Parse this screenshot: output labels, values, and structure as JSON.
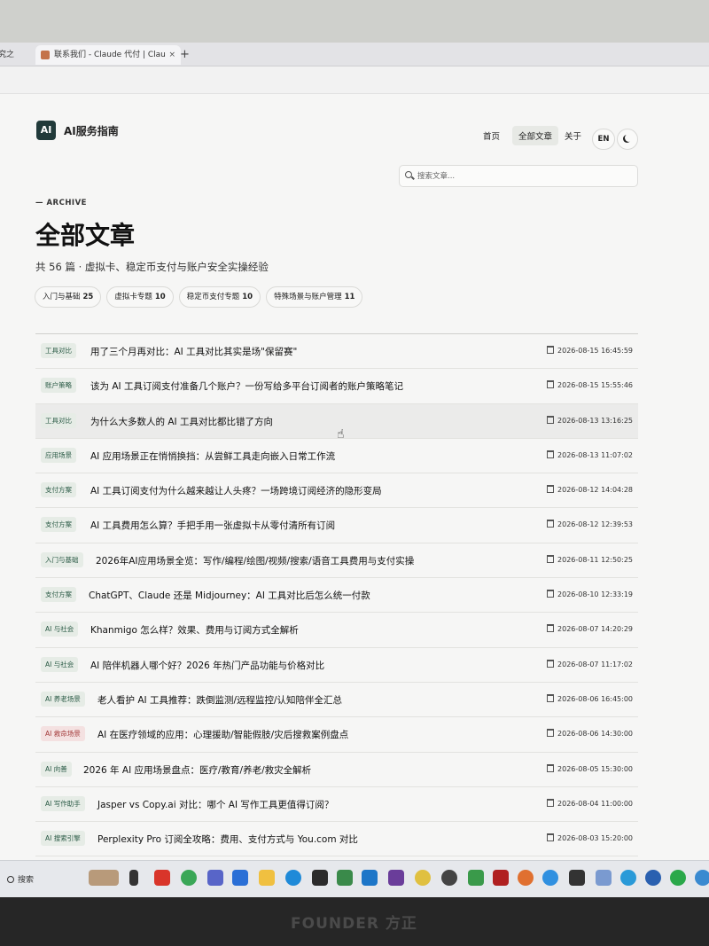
{
  "browser": {
    "tab1_label": "究之",
    "tab2_label": "联系我们 - Claude 代付 | Clau",
    "close_glyph": "×",
    "new_tab_glyph": "+"
  },
  "site": {
    "logo_text": "AI",
    "title": "AI服务指南",
    "nav": [
      "首页",
      "全部文章",
      "关于"
    ],
    "lang_button": "EN",
    "search_placeholder": "搜索文章..."
  },
  "hero": {
    "eyebrow": "— ARCHIVE",
    "title": "全部文章",
    "subtitle": "共 56 篇 · 虚拟卡、稳定币支付与账户安全实操经验"
  },
  "filters": [
    {
      "label": "入门与基础",
      "count": "25"
    },
    {
      "label": "虚拟卡专题",
      "count": "10"
    },
    {
      "label": "稳定币支付专题",
      "count": "10"
    },
    {
      "label": "特殊场景与账户管理",
      "count": "11"
    }
  ],
  "articles": [
    {
      "tag": "工具对比",
      "title": "用了三个月再对比：AI 工具对比其实是场\"保留赛\"",
      "date": "2026-08-15 16:45:59"
    },
    {
      "tag": "账户策略",
      "title": "该为 AI 工具订阅支付准备几个账户？一份写给多平台订阅者的账户策略笔记",
      "date": "2026-08-15 15:55:46"
    },
    {
      "tag": "工具对比",
      "title": "为什么大多数人的 AI 工具对比都比错了方向",
      "date": "2026-08-13 13:16:25"
    },
    {
      "tag": "应用场景",
      "title": "AI 应用场景正在悄悄换挡：从尝鲜工具走向嵌入日常工作流",
      "date": "2026-08-13 11:07:02"
    },
    {
      "tag": "支付方案",
      "title": "AI 工具订阅支付为什么越来越让人头疼？一场跨境订阅经济的隐形变局",
      "date": "2026-08-12 14:04:28"
    },
    {
      "tag": "支付方案",
      "title": "AI 工具费用怎么算？手把手用一张虚拟卡从零付清所有订阅",
      "date": "2026-08-12 12:39:53"
    },
    {
      "tag": "入门与基础",
      "title": "2026年AI应用场景全览：写作/编程/绘图/视频/搜索/语音工具费用与支付实操",
      "date": "2026-08-11 12:50:25"
    },
    {
      "tag": "支付方案",
      "title": "ChatGPT、Claude 还是 Midjourney：AI 工具对比后怎么统一付款",
      "date": "2026-08-10 12:33:19"
    },
    {
      "tag": "AI 与社会",
      "title": "Khanmigo 怎么样？效果、费用与订阅方式全解析",
      "date": "2026-08-07 14:20:29"
    },
    {
      "tag": "AI 与社会",
      "title": "AI 陪伴机器人哪个好？2026 年热门产品功能与价格对比",
      "date": "2026-08-07 11:17:02"
    },
    {
      "tag": "AI 养老场景",
      "title": "老人看护 AI 工具推荐：跌倒监测/远程监控/认知陪伴全汇总",
      "date": "2026-08-06 16:45:00"
    },
    {
      "tag": "AI 救命场景",
      "title": "AI 在医疗领域的应用：心理援助/智能假肢/灾后搜救案例盘点",
      "date": "2026-08-06 14:30:00"
    },
    {
      "tag": "AI 向善",
      "title": "2026 年 AI 应用场景盘点：医疗/教育/养老/救灾全解析",
      "date": "2026-08-05 15:30:00"
    },
    {
      "tag": "AI 写作助手",
      "title": "Jasper vs Copy.ai 对比：哪个 AI 写作工具更值得订阅？",
      "date": "2026-08-04 11:00:00"
    },
    {
      "tag": "AI 搜索引擎",
      "title": "Perplexity Pro 订阅全攻略：费用、支付方式与 You.com 对比",
      "date": "2026-08-03 15:20:00"
    }
  ],
  "taskbar": {
    "search_label": "搜索"
  },
  "monitor": {
    "brand": "FOUNDER 方正"
  },
  "colors": {
    "tag_green_bg": "#e6ece6",
    "tag_red_bg": "#f4e1e1",
    "logo_bg": "#213a3a"
  }
}
